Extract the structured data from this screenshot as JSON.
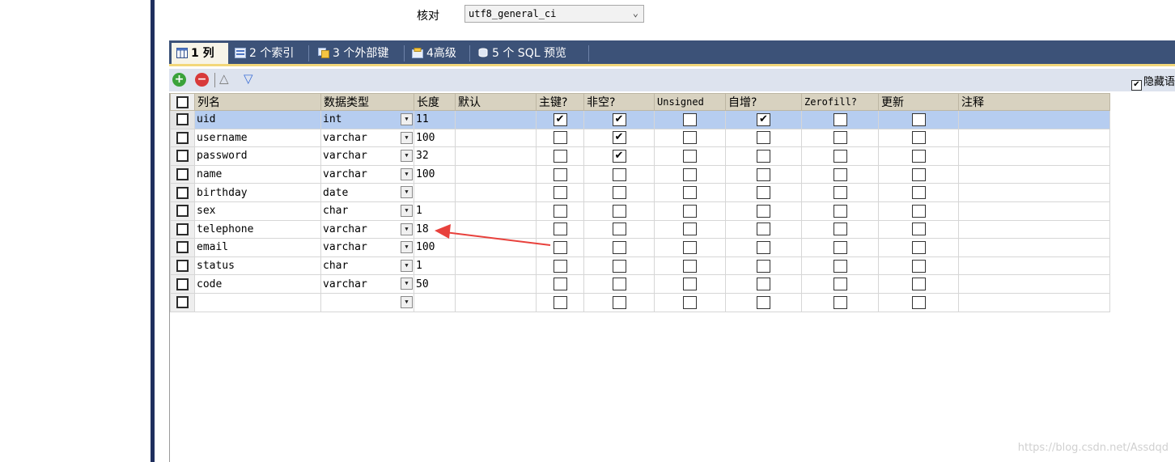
{
  "collation": {
    "label": "核对",
    "value": "utf8_general_ci"
  },
  "tabs": [
    {
      "label": "1 列",
      "active": true,
      "icon": "columns-icon"
    },
    {
      "label": "2 个索引",
      "icon": "indexes-icon"
    },
    {
      "label": "3 个外部键",
      "icon": "foreign-keys-icon"
    },
    {
      "label": "4高级",
      "icon": "advanced-icon"
    },
    {
      "label": "5 个 SQL 预览",
      "icon": "sql-preview-icon"
    }
  ],
  "toolbar": {
    "add_symbol": "+",
    "remove_symbol": "−",
    "up_symbol": "△",
    "down_symbol": "▽",
    "hide_language_label": "隐藏语",
    "hide_language_checked": true
  },
  "columns": {
    "name": "列名",
    "type": "数据类型",
    "length": "长度",
    "default": "默认",
    "pk": "主键?",
    "not_null": "非空?",
    "unsigned": "Unsigned",
    "auto_inc": "自增?",
    "zerofill": "Zerofill?",
    "on_update": "更新",
    "comment": "注释"
  },
  "rows": [
    {
      "name": "uid",
      "type": "int",
      "length": "11",
      "default": "",
      "pk": true,
      "not_null": true,
      "unsigned": false,
      "auto_inc": true,
      "zerofill": false,
      "on_update": false,
      "comment": "",
      "selected": true
    },
    {
      "name": "username",
      "type": "varchar",
      "length": "100",
      "default": "",
      "pk": false,
      "not_null": true,
      "unsigned": false,
      "auto_inc": false,
      "zerofill": false,
      "on_update": false,
      "comment": ""
    },
    {
      "name": "password",
      "type": "varchar",
      "length": "32",
      "default": "",
      "pk": false,
      "not_null": true,
      "unsigned": false,
      "auto_inc": false,
      "zerofill": false,
      "on_update": false,
      "comment": ""
    },
    {
      "name": "name",
      "type": "varchar",
      "length": "100",
      "default": "",
      "pk": false,
      "not_null": false,
      "unsigned": false,
      "auto_inc": false,
      "zerofill": false,
      "on_update": false,
      "comment": ""
    },
    {
      "name": "birthday",
      "type": "date",
      "length": "",
      "default": "",
      "pk": false,
      "not_null": false,
      "unsigned": false,
      "auto_inc": false,
      "zerofill": false,
      "on_update": false,
      "comment": ""
    },
    {
      "name": "sex",
      "type": "char",
      "length": "1",
      "default": "",
      "pk": false,
      "not_null": false,
      "unsigned": false,
      "auto_inc": false,
      "zerofill": false,
      "on_update": false,
      "comment": ""
    },
    {
      "name": "telephone",
      "type": "varchar",
      "length": "18",
      "default": "",
      "pk": false,
      "not_null": false,
      "unsigned": false,
      "auto_inc": false,
      "zerofill": false,
      "on_update": false,
      "comment": ""
    },
    {
      "name": "email",
      "type": "varchar",
      "length": "100",
      "default": "",
      "pk": false,
      "not_null": false,
      "unsigned": false,
      "auto_inc": false,
      "zerofill": false,
      "on_update": false,
      "comment": ""
    },
    {
      "name": "status",
      "type": "char",
      "length": "1",
      "default": "",
      "pk": false,
      "not_null": false,
      "unsigned": false,
      "auto_inc": false,
      "zerofill": false,
      "on_update": false,
      "comment": ""
    },
    {
      "name": "code",
      "type": "varchar",
      "length": "50",
      "default": "",
      "pk": false,
      "not_null": false,
      "unsigned": false,
      "auto_inc": false,
      "zerofill": false,
      "on_update": false,
      "comment": ""
    },
    {
      "name": "",
      "type": "",
      "length": "",
      "default": "",
      "pk": false,
      "not_null": false,
      "unsigned": false,
      "auto_inc": false,
      "zerofill": false,
      "on_update": false,
      "comment": ""
    }
  ],
  "check_mark": "✔",
  "dropdown_glyph": "▼",
  "watermark": "https://blog.csdn.net/Assdqd",
  "colors": {
    "tab_bar": "#3c5278",
    "selected_row": "#b6cdf0",
    "arrow": "#e8413c",
    "header": "#d8d2c0"
  }
}
